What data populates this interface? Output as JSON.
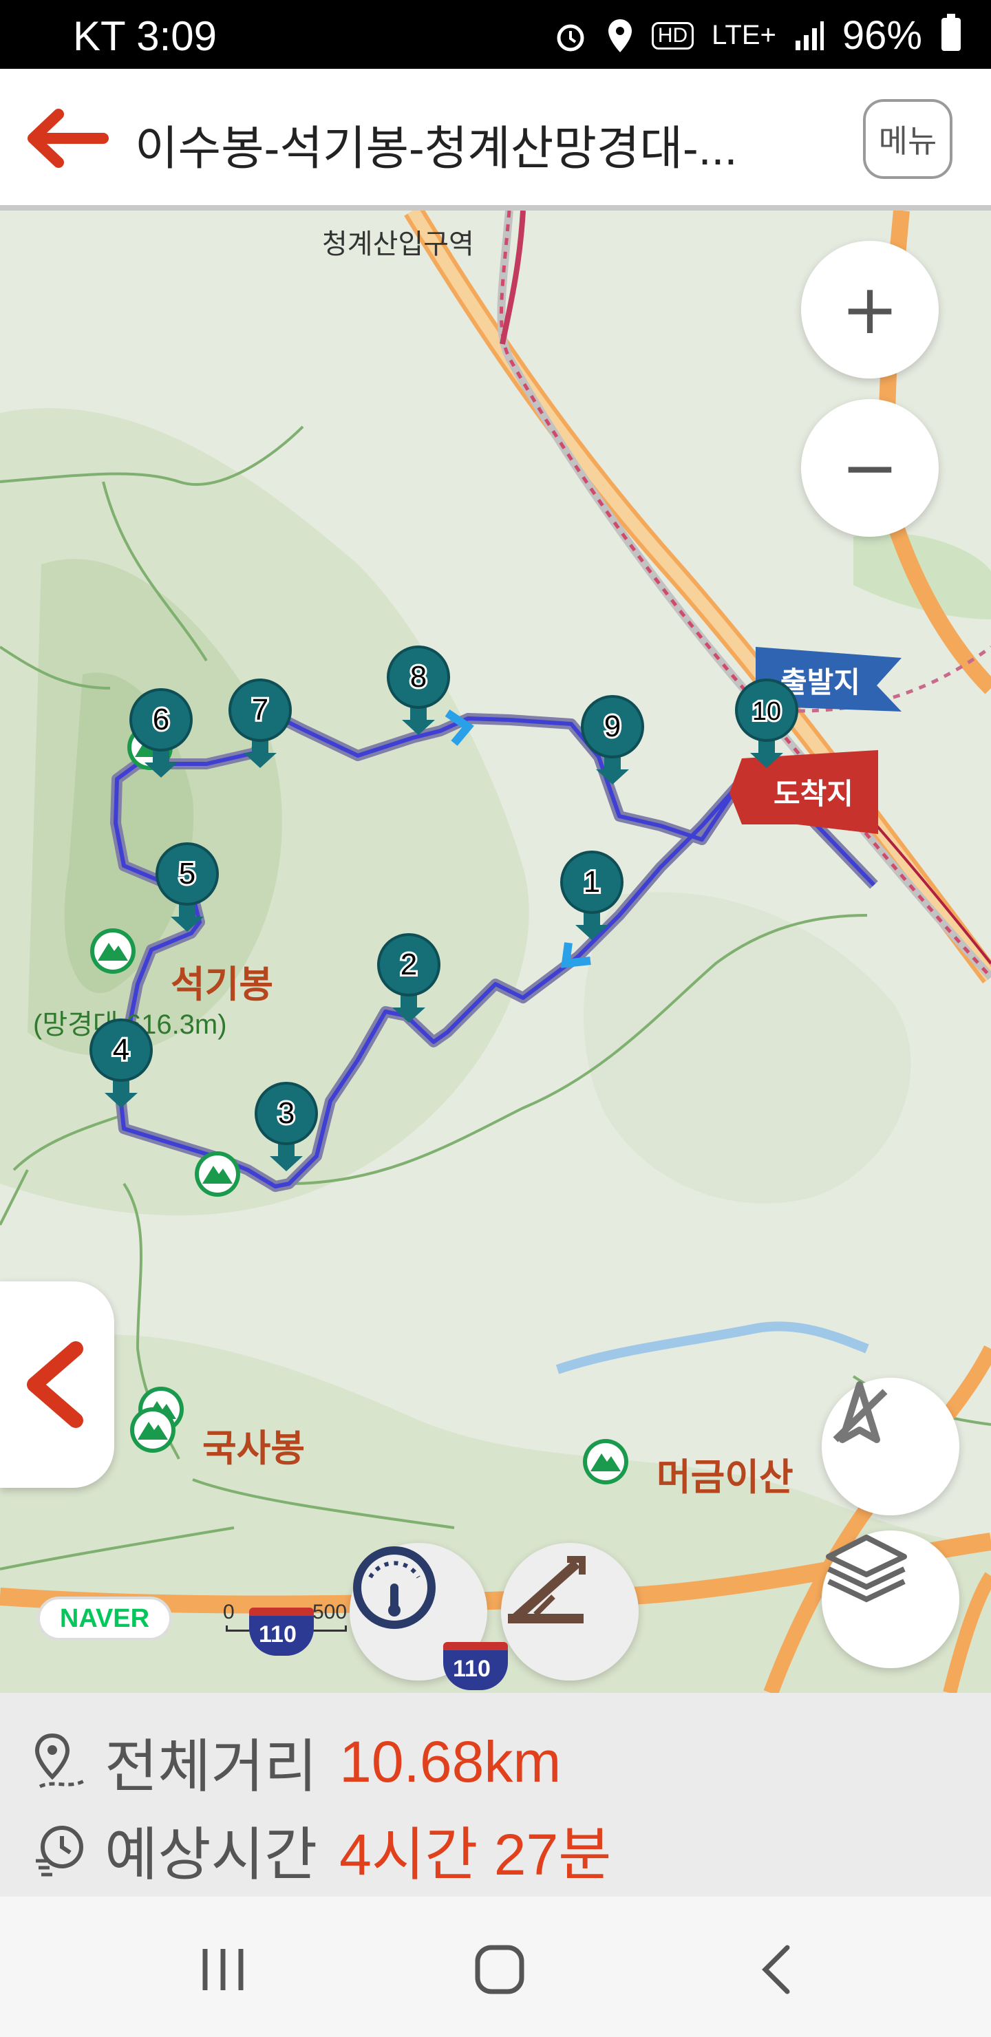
{
  "status_bar": {
    "time": "KT 3:09",
    "network": "LTE+",
    "hd": "HD",
    "battery": "96%"
  },
  "header": {
    "title": "이수봉-석기봉-청계산망경대-...",
    "menu_label": "메뉴"
  },
  "map": {
    "place_labels": {
      "entrance": "청계산입구역",
      "seokgibong": "석기봉",
      "manggyeongdae": "(망경대 616.3m)",
      "guksabong": "국사봉",
      "meogeumisan": "머금이산"
    },
    "flags": {
      "start": "출발지",
      "end": "도착지"
    },
    "waypoints": [
      "1",
      "2",
      "3",
      "4",
      "5",
      "6",
      "7",
      "8",
      "9",
      "10"
    ],
    "scale": {
      "zero": "0",
      "max": "500"
    },
    "road_signs": [
      "110",
      "110"
    ],
    "provider": "NAVER",
    "colors": {
      "route": "#4a55c8",
      "marker": "#166e76",
      "start_flag": "#2f64b3",
      "end_flag": "#c8322c",
      "accent": "#e0401c"
    }
  },
  "controls": {
    "zoom_in": "+",
    "zoom_out": "−"
  },
  "summary": {
    "distance_label": "전체거리",
    "distance_value": "10.68km",
    "time_label": "예상시간",
    "time_value": "4시간 27분"
  }
}
